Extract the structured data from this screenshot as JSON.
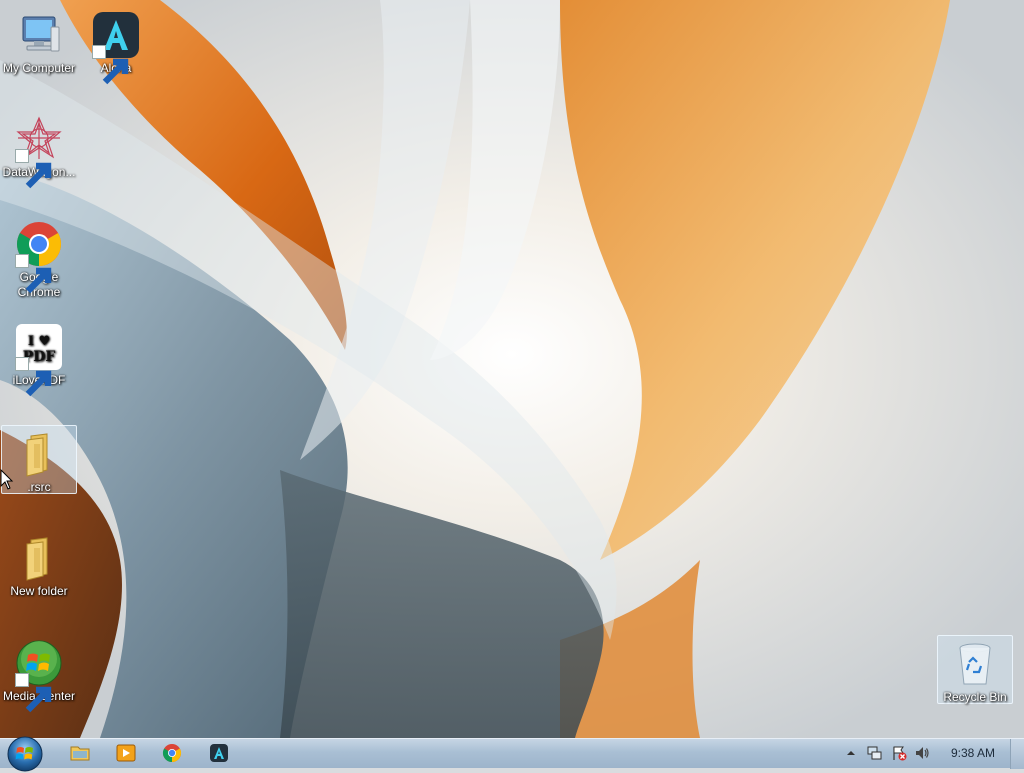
{
  "desktop": {
    "icons": [
      {
        "label": "My Computer"
      },
      {
        "label": "Aloha"
      },
      {
        "label": "DataWagon..."
      },
      {
        "label": "Google Chrome"
      },
      {
        "label": "iLovePDF",
        "logo_text": "I ♥ PDF"
      },
      {
        "label": ".rsrc"
      },
      {
        "label": "New folder"
      },
      {
        "label": "Media Center"
      },
      {
        "label": "Recycle Bin"
      }
    ]
  },
  "taskbar": {
    "pinned": [
      {
        "name": "Windows Explorer",
        "icon": "folder-icon"
      },
      {
        "name": "Windows Media Player",
        "icon": "media-player-icon"
      },
      {
        "name": "Google Chrome",
        "icon": "chrome-icon"
      },
      {
        "name": "Aloha",
        "icon": "aloha-icon"
      }
    ],
    "tray": {
      "icons": [
        "show-hidden-icons-arrow",
        "network-icon",
        "action-center-flag-icon",
        "volume-icon"
      ],
      "clock": "9:38 AM"
    }
  },
  "colors": {
    "taskbar": "#a9bfd4",
    "wallpaper_orange": "#d9751f",
    "wallpaper_blue": "#6f8fa3",
    "selection": "#cde4f5"
  }
}
